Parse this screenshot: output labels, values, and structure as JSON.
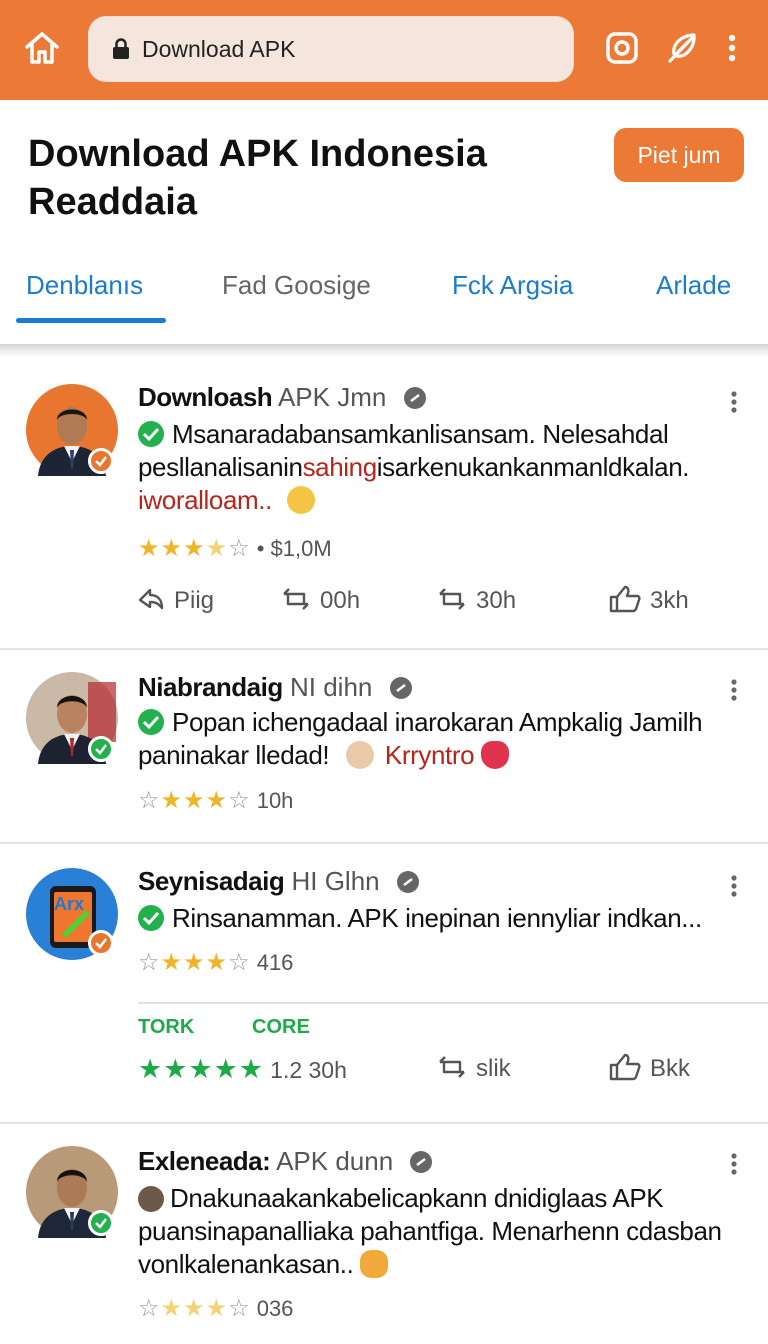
{
  "browser": {
    "url_text": "Download APK"
  },
  "header": {
    "title": "Download APK Indonesia Readdaia",
    "cta_label": "Piet jum"
  },
  "tabs": [
    {
      "label": "Denblanıs"
    },
    {
      "label": "Fad Goosige"
    },
    {
      "label": "Fck Argsia"
    },
    {
      "label": "Arlade"
    }
  ],
  "posts": [
    {
      "name": "Downloash",
      "handle": "APK Jmn",
      "text_1": "Msanaradabansamkanlisansam. Nelesahdal pesllanalisanin",
      "text_red_inline": "sahing",
      "text_2": "isarkenukankanmanldkalan.",
      "text_red_line": "iworalloam..",
      "rating_text": "• $1,0M",
      "actions": [
        {
          "label": "Piig"
        },
        {
          "label": "00h"
        },
        {
          "label": "30h"
        },
        {
          "label": "3kh"
        }
      ]
    },
    {
      "name": "Niabrandaig",
      "handle": "NI dihn",
      "text_1": "Popan ichengadaal inarokaran Ampkalig Jamilh paninakar lledad!",
      "text_red_inline": "Krryntro",
      "rating_text": "10h"
    },
    {
      "name": "Seynisadaig",
      "handle": "HI Glhn",
      "avatar_label": "Arx",
      "text_1": "Rinsanamman. APK inepinan iennyliar indkan...",
      "rating_text": "416",
      "sub_labels": [
        "TORK",
        "CORE"
      ],
      "score_text": "1.2 30h",
      "actions": [
        {
          "label": "slik"
        },
        {
          "label": "Bkk"
        }
      ]
    },
    {
      "name": "Exleneada:",
      "handle": "APK dunn",
      "text_1": "Dnakunaakankabelicapkann dnidiglaas APK puansinapanalliaka pahantfiga. Menarhenn cdasban vonlkalenankasan..",
      "rating_text": "036"
    }
  ],
  "colors": {
    "brand_orange": "#ec7a36",
    "link_blue": "#1a7bd0",
    "verified_green": "#23b14d",
    "star_gold": "#f0b429",
    "accent_red": "#b8241c"
  },
  "icons": [
    "home-icon",
    "lock-icon",
    "camera-icon",
    "feather-icon",
    "more-vert-icon",
    "verified-icon",
    "check-icon",
    "share-icon",
    "repost-icon",
    "like-icon"
  ]
}
